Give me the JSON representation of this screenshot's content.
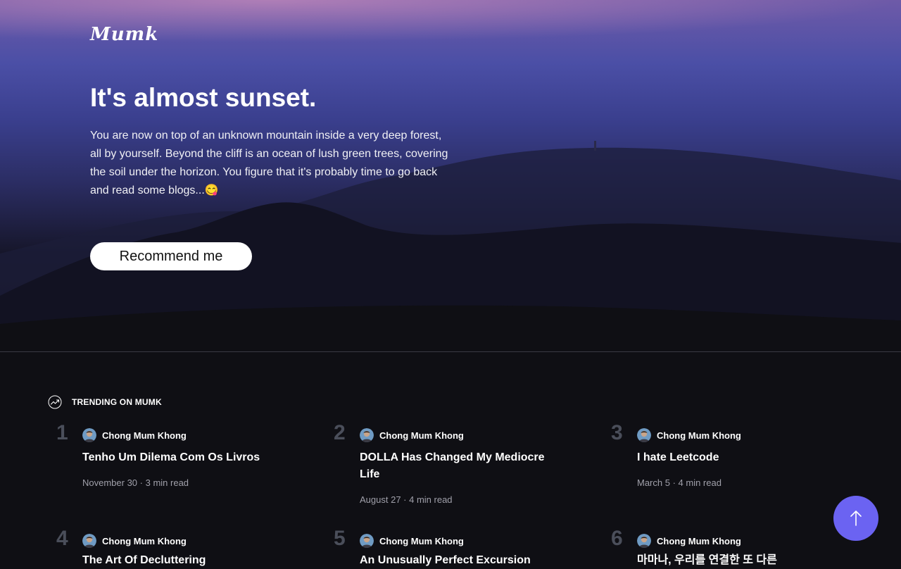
{
  "header": {
    "logo": "Mumk"
  },
  "hero": {
    "title": "It's almost sunset.",
    "description": "You are now on top of an unknown mountain inside a very deep forest, all by yourself. Beyond the cliff is an ocean of lush green trees, covering the soil under the horizon. You figure that it's probably time to go back and read some blogs...😋",
    "button_label": "Recommend me"
  },
  "trending": {
    "label": "TRENDING ON MUMK",
    "items": [
      {
        "rank": "1",
        "author": "Chong Mum Khong",
        "title": "Tenho Um Dilema Com Os Livros",
        "date": "November 30",
        "read_time": "3 min read"
      },
      {
        "rank": "2",
        "author": "Chong Mum Khong",
        "title": "DOLLA Has Changed My Mediocre Life",
        "date": "August 27",
        "read_time": "4 min read"
      },
      {
        "rank": "3",
        "author": "Chong Mum Khong",
        "title": "I hate Leetcode",
        "date": "March 5",
        "read_time": "4 min read"
      },
      {
        "rank": "4",
        "author": "Chong Mum Khong",
        "title": "The Art Of Decluttering",
        "date": "",
        "read_time": ""
      },
      {
        "rank": "5",
        "author": "Chong Mum Khong",
        "title": "An Unusually Perfect Excursion",
        "date": "",
        "read_time": ""
      },
      {
        "rank": "6",
        "author": "Chong Mum Khong",
        "title": "마마나, 우리를 연결한 또 다른",
        "date": "",
        "read_time": ""
      }
    ]
  },
  "icons": {
    "trending": "trending-up-icon",
    "scroll_top": "arrow-up-icon"
  },
  "colors": {
    "accent": "#6b63f2",
    "background": "#0f0f14",
    "rank": "#4a4e5a",
    "meta": "#a0a0aa"
  }
}
